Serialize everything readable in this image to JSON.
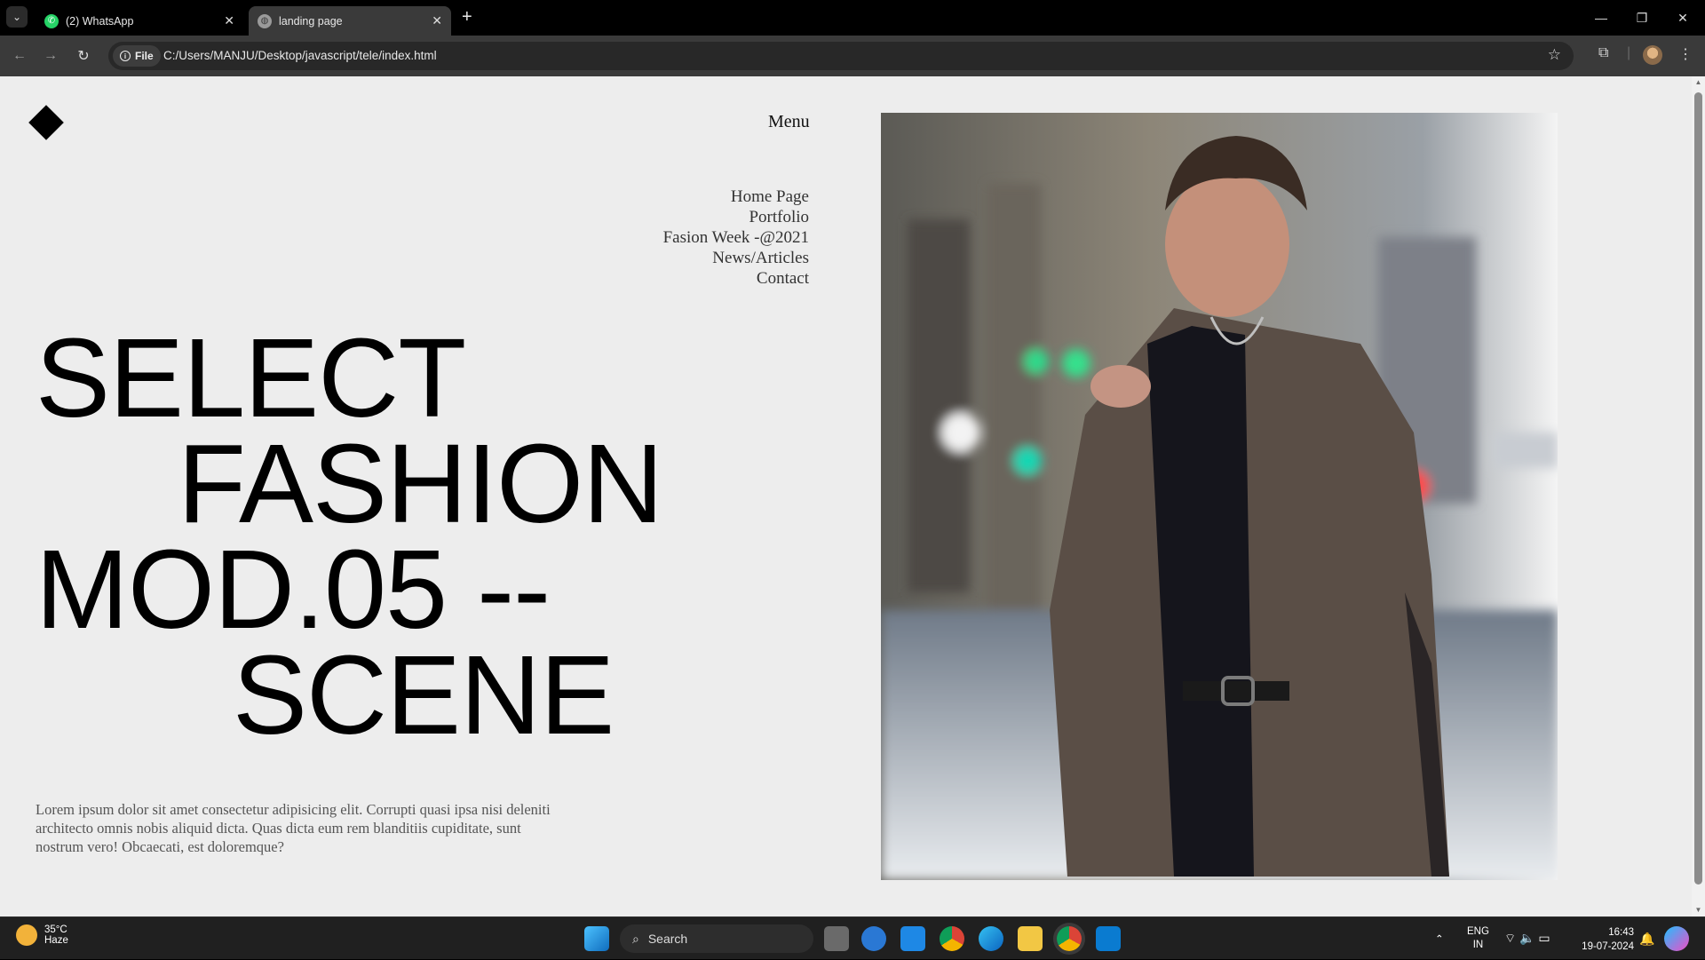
{
  "browser": {
    "tabs": [
      {
        "title": "(2) WhatsApp",
        "active": false
      },
      {
        "title": "landing page",
        "active": true
      }
    ],
    "site_chip": "File",
    "url": "C:/Users/MANJU/Desktop/javascript/tele/index.html"
  },
  "page": {
    "menu_label": "Menu",
    "nav_items": [
      "Home Page",
      "Portfolio",
      "Fasion Week -@2021",
      "News/Articles",
      "Contact"
    ],
    "headline": [
      "SELECT",
      "FASHION",
      "MOD.05 --",
      "SCENE"
    ],
    "body_text": "Lorem ipsum dolor sit amet consectetur adipisicing elit. Corrupti quasi ipsa nisi deleniti architecto omnis nobis aliquid dicta. Quas dicta eum rem blanditiis cupiditate, sunt nostrum vero! Obcaecati, est doloremque?"
  },
  "taskbar": {
    "weather_temp": "35°C",
    "weather_desc": "Haze",
    "search_placeholder": "Search",
    "lang_top": "ENG",
    "lang_bottom": "IN",
    "time": "16:43",
    "date": "19-07-2024"
  },
  "colors": {
    "page_bg": "#ededed",
    "headline": "#000000",
    "nav_text": "#333333"
  }
}
